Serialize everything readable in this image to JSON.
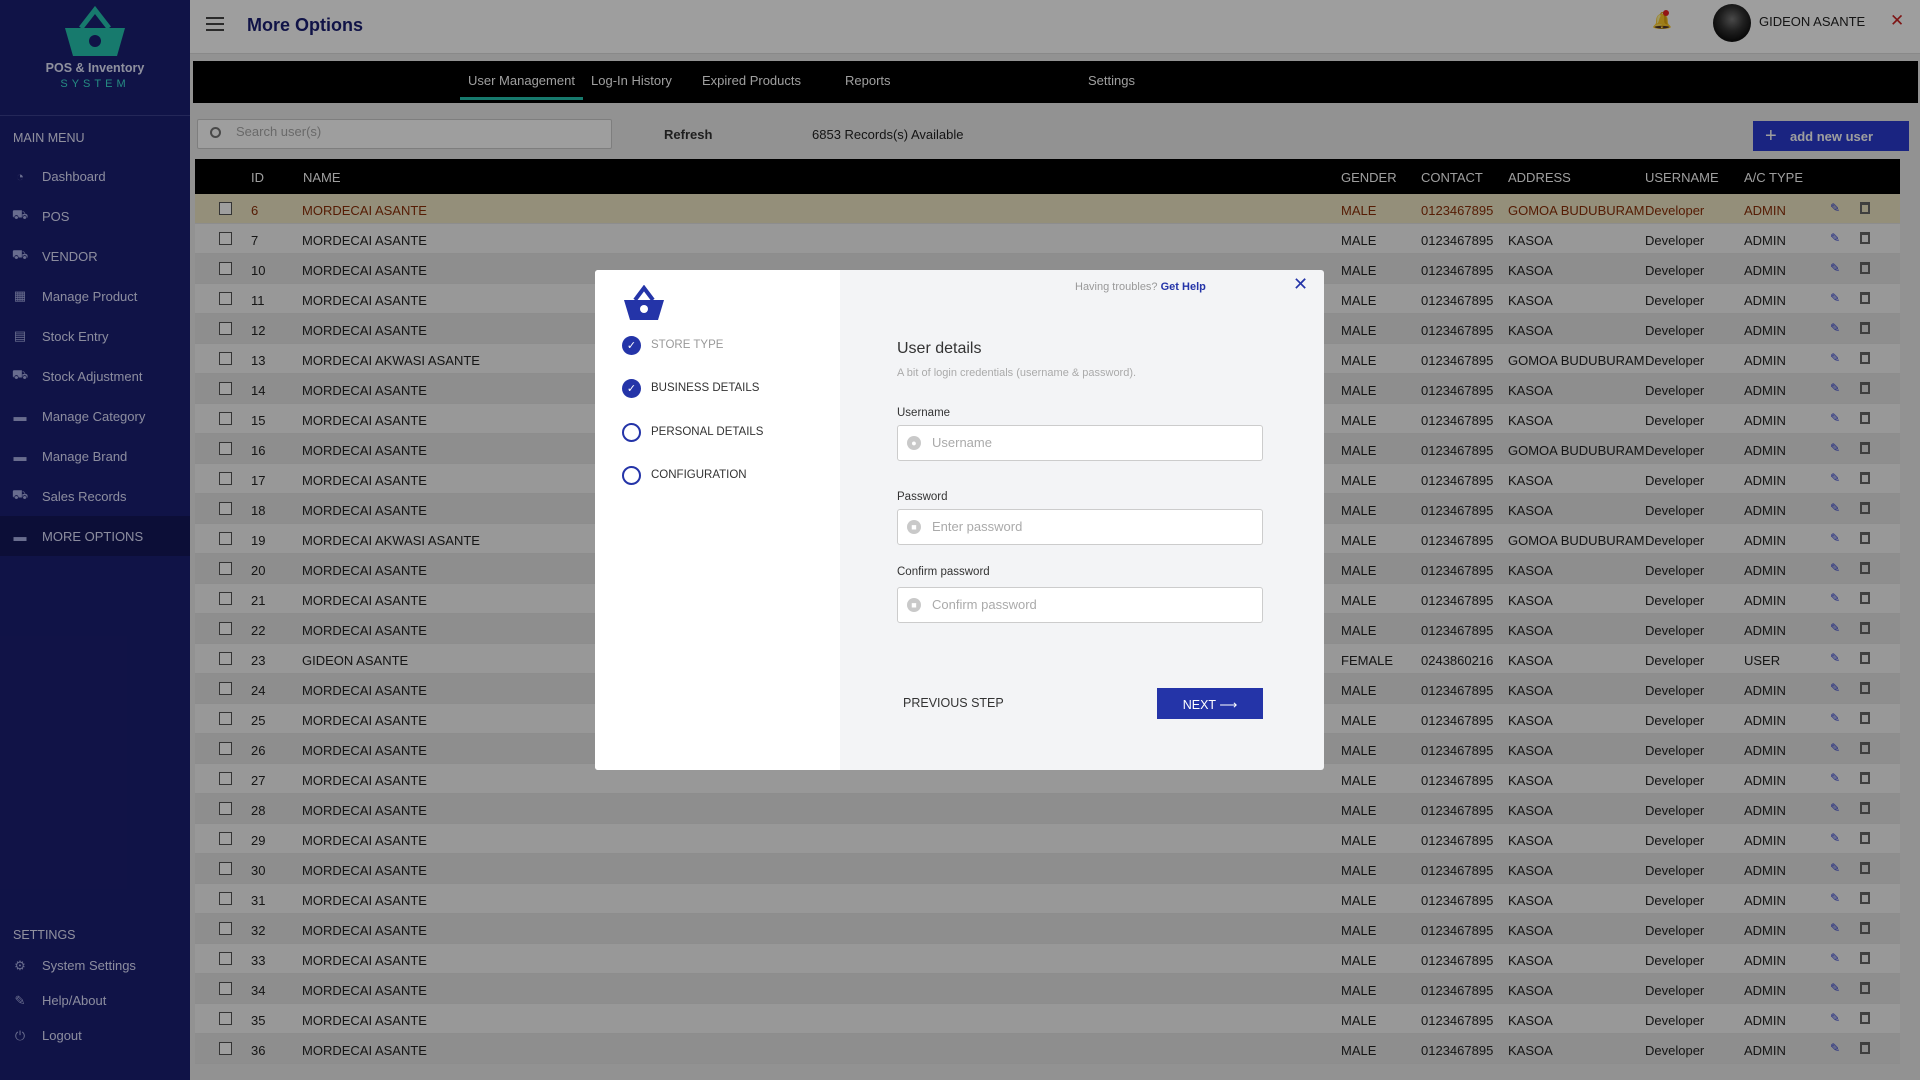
{
  "brand": {
    "line1": "POS & Inventory",
    "line2": "SYSTEM"
  },
  "sidebar": {
    "main_menu_label": "MAIN MENU",
    "items": [
      {
        "label": "Dashboard",
        "icon": "dashboard-icon"
      },
      {
        "label": "POS",
        "icon": "cart-icon"
      },
      {
        "label": "VENDOR",
        "icon": "vendor-icon"
      },
      {
        "label": "Manage Product",
        "icon": "product-icon"
      },
      {
        "label": "Stock Entry",
        "icon": "stock-entry-icon"
      },
      {
        "label": "Stock Adjustment",
        "icon": "stock-adjust-icon"
      },
      {
        "label": "Manage Category",
        "icon": "folder-icon"
      },
      {
        "label": "Manage Brand",
        "icon": "brand-icon"
      },
      {
        "label": "Sales Records",
        "icon": "sales-icon"
      },
      {
        "label": "MORE OPTIONS",
        "icon": "more-icon"
      }
    ],
    "settings_label": "SETTINGS",
    "settings_items": [
      {
        "label": "System Settings",
        "icon": "gear-icon"
      },
      {
        "label": "Help/About",
        "icon": "help-icon"
      },
      {
        "label": "Logout",
        "icon": "logout-icon"
      }
    ]
  },
  "header": {
    "title": "More Options",
    "user_name": "GIDEON ASANTE"
  },
  "tabs": [
    "User Management",
    "Log-In History",
    "Expired Products",
    "Reports",
    "Settings"
  ],
  "toolbar": {
    "search_placeholder": "Search user(s)",
    "refresh_label": "Refresh",
    "records_text": "6853 Records(s) Available",
    "add_label": "add new user"
  },
  "table": {
    "columns": [
      "ID",
      "NAME",
      "GENDER",
      "CONTACT",
      "ADDRESS",
      "USERNAME",
      "A/C TYPE"
    ],
    "rows": [
      [
        "6",
        "MORDECAI ASANTE",
        "MALE",
        "0123467895",
        "GOMOA BUDUBURAM",
        "Developer",
        "ADMIN"
      ],
      [
        "7",
        "MORDECAI ASANTE",
        "MALE",
        "0123467895",
        "KASOA",
        "Developer",
        "ADMIN"
      ],
      [
        "10",
        "MORDECAI ASANTE",
        "MALE",
        "0123467895",
        "KASOA",
        "Developer",
        "ADMIN"
      ],
      [
        "11",
        "MORDECAI ASANTE",
        "MALE",
        "0123467895",
        "KASOA",
        "Developer",
        "ADMIN"
      ],
      [
        "12",
        "MORDECAI ASANTE",
        "MALE",
        "0123467895",
        "KASOA",
        "Developer",
        "ADMIN"
      ],
      [
        "13",
        "MORDECAI AKWASI ASANTE",
        "MALE",
        "0123467895",
        "GOMOA BUDUBURAM",
        "Developer",
        "ADMIN"
      ],
      [
        "14",
        "MORDECAI ASANTE",
        "MALE",
        "0123467895",
        "KASOA",
        "Developer",
        "ADMIN"
      ],
      [
        "15",
        "MORDECAI ASANTE",
        "MALE",
        "0123467895",
        "KASOA",
        "Developer",
        "ADMIN"
      ],
      [
        "16",
        "MORDECAI ASANTE",
        "MALE",
        "0123467895",
        "GOMOA BUDUBURAM",
        "Developer",
        "ADMIN"
      ],
      [
        "17",
        "MORDECAI ASANTE",
        "MALE",
        "0123467895",
        "KASOA",
        "Developer",
        "ADMIN"
      ],
      [
        "18",
        "MORDECAI ASANTE",
        "MALE",
        "0123467895",
        "KASOA",
        "Developer",
        "ADMIN"
      ],
      [
        "19",
        "MORDECAI AKWASI ASANTE",
        "MALE",
        "0123467895",
        "GOMOA BUDUBURAM",
        "Developer",
        "ADMIN"
      ],
      [
        "20",
        "MORDECAI ASANTE",
        "MALE",
        "0123467895",
        "KASOA",
        "Developer",
        "ADMIN"
      ],
      [
        "21",
        "MORDECAI ASANTE",
        "MALE",
        "0123467895",
        "KASOA",
        "Developer",
        "ADMIN"
      ],
      [
        "22",
        "MORDECAI ASANTE",
        "MALE",
        "0123467895",
        "KASOA",
        "Developer",
        "ADMIN"
      ],
      [
        "23",
        "GIDEON ASANTE",
        "FEMALE",
        "0243860216",
        "KASOA",
        "Developer",
        "USER"
      ],
      [
        "24",
        "MORDECAI ASANTE",
        "MALE",
        "0123467895",
        "KASOA",
        "Developer",
        "ADMIN"
      ],
      [
        "25",
        "MORDECAI ASANTE",
        "MALE",
        "0123467895",
        "KASOA",
        "Developer",
        "ADMIN"
      ],
      [
        "26",
        "MORDECAI ASANTE",
        "MALE",
        "0123467895",
        "KASOA",
        "Developer",
        "ADMIN"
      ],
      [
        "27",
        "MORDECAI ASANTE",
        "MALE",
        "0123467895",
        "KASOA",
        "Developer",
        "ADMIN"
      ],
      [
        "28",
        "MORDECAI ASANTE",
        "MALE",
        "0123467895",
        "KASOA",
        "Developer",
        "ADMIN"
      ],
      [
        "29",
        "MORDECAI ASANTE",
        "MALE",
        "0123467895",
        "KASOA",
        "Developer",
        "ADMIN"
      ],
      [
        "30",
        "MORDECAI ASANTE",
        "MALE",
        "0123467895",
        "KASOA",
        "Developer",
        "ADMIN"
      ],
      [
        "31",
        "MORDECAI ASANTE",
        "MALE",
        "0123467895",
        "KASOA",
        "Developer",
        "ADMIN"
      ],
      [
        "32",
        "MORDECAI ASANTE",
        "MALE",
        "0123467895",
        "KASOA",
        "Developer",
        "ADMIN"
      ],
      [
        "33",
        "MORDECAI ASANTE",
        "MALE",
        "0123467895",
        "KASOA",
        "Developer",
        "ADMIN"
      ],
      [
        "34",
        "MORDECAI ASANTE",
        "MALE",
        "0123467895",
        "KASOA",
        "Developer",
        "ADMIN"
      ],
      [
        "35",
        "MORDECAI ASANTE",
        "MALE",
        "0123467895",
        "KASOA",
        "Developer",
        "ADMIN"
      ],
      [
        "36",
        "MORDECAI ASANTE",
        "MALE",
        "0123467895",
        "KASOA",
        "Developer",
        "ADMIN"
      ]
    ]
  },
  "modal": {
    "trouble_text": "Having troubles?",
    "help_link": "Get Help",
    "steps": [
      {
        "label": "STORE TYPE",
        "done": true
      },
      {
        "label": "BUSINESS DETAILS",
        "done": true
      },
      {
        "label": "PERSONAL DETAILS",
        "done": false
      },
      {
        "label": "CONFIGURATION",
        "done": false
      }
    ],
    "title": "User details",
    "subtitle": "A bit of login credentials (username & password).",
    "username_label": "Username",
    "username_placeholder": "Username",
    "password_label": "Password",
    "password_placeholder": "Enter password",
    "confirm_label": "Confirm password",
    "confirm_placeholder": "Confirm password",
    "prev_label": "PREVIOUS STEP",
    "next_label": "NEXT ⟶"
  },
  "colors": {
    "sidebar": "#1b1f73",
    "accent": "#2434a8",
    "tab_underline": "#26c6b0"
  }
}
